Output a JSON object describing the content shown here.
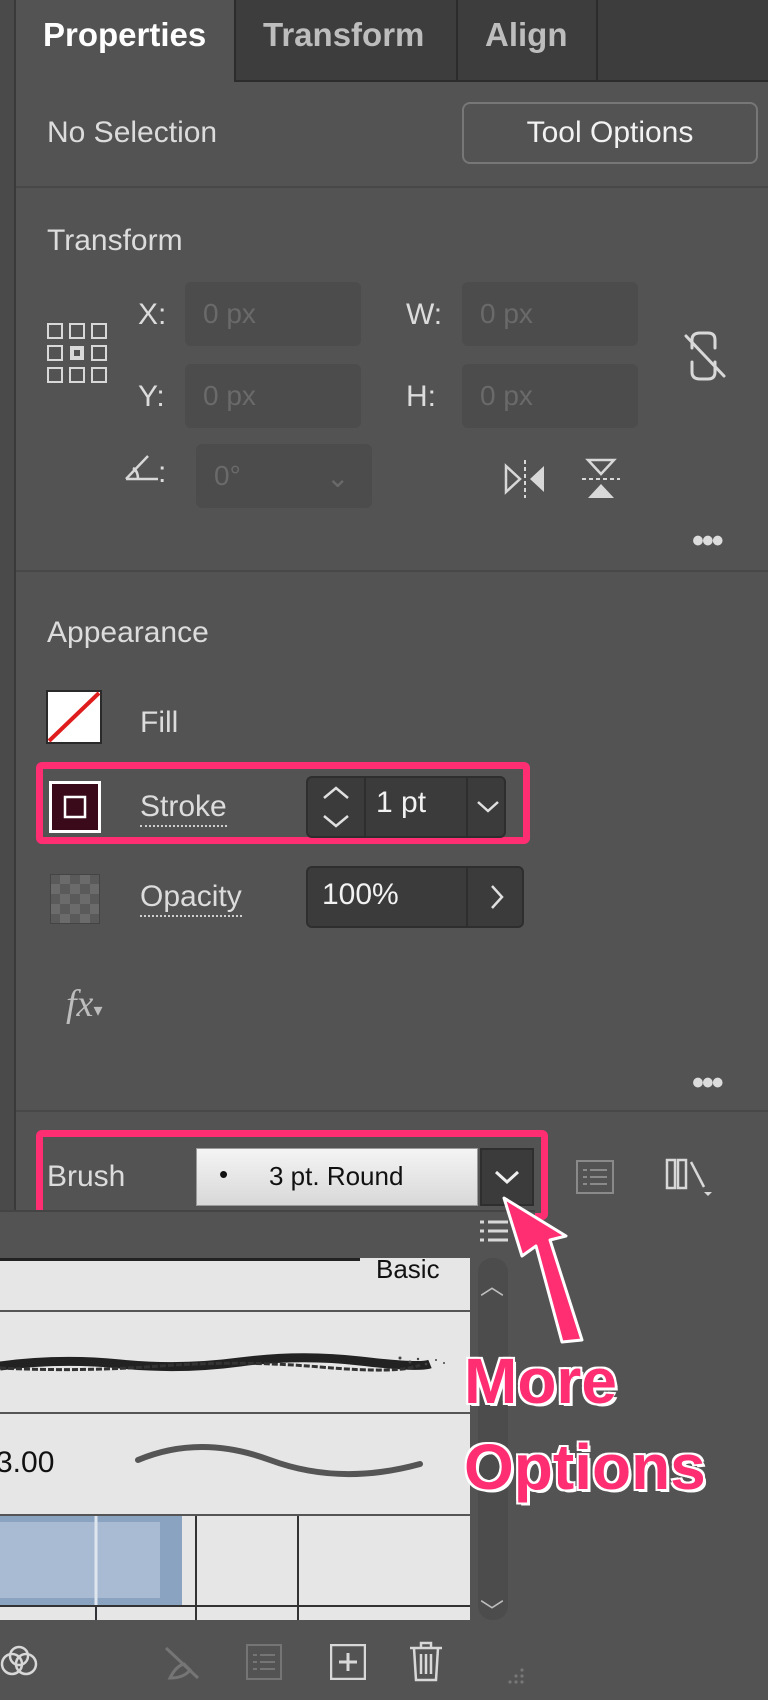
{
  "tabs": [
    {
      "label": "Properties",
      "active": true
    },
    {
      "label": "Transform",
      "active": false
    },
    {
      "label": "Align",
      "active": false
    }
  ],
  "selection": {
    "status": "No Selection",
    "tool_options_label": "Tool Options"
  },
  "transform": {
    "title": "Transform",
    "x_label": "X:",
    "x_value": "0 px",
    "y_label": "Y:",
    "y_value": "0 px",
    "w_label": "W:",
    "w_value": "0 px",
    "h_label": "H:",
    "h_value": "0 px",
    "angle_label": ":",
    "angle_value": "0°"
  },
  "appearance": {
    "title": "Appearance",
    "fill_label": "Fill",
    "stroke_label": "Stroke",
    "stroke_value": "1 pt",
    "opacity_label": "Opacity",
    "opacity_value": "100%",
    "fx_label": "fx"
  },
  "brush": {
    "label": "Brush",
    "selected": "3 pt. Round"
  },
  "brush_library": {
    "header_text": "Basic",
    "size_value": "3.00"
  },
  "annotation": {
    "line1": "More",
    "line2": "Options",
    "color": "#ff2e73"
  },
  "colors": {
    "panel_bg": "#535353",
    "highlight": "#ff2e73",
    "fill_none_slash": "#e01d1d"
  }
}
